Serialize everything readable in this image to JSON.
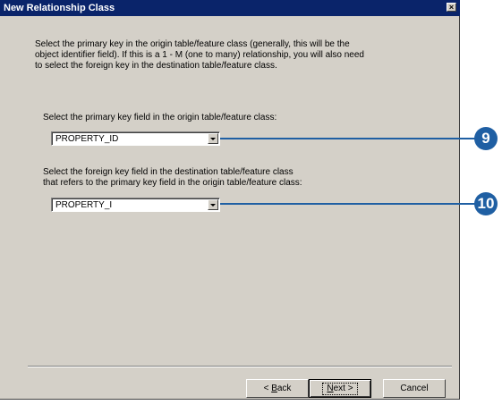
{
  "window": {
    "title": "New Relationship Class",
    "close_glyph": "×"
  },
  "instructions": [
    "Select the primary key in the origin table/feature class (generally, this will be the",
    "object identifier field). If this is a 1 - M (one to many) relationship, you will also need",
    "to select the foreign key in the destination table/feature class."
  ],
  "primary_key": {
    "label": "Select the primary key field in the origin table/feature class:",
    "value": "PROPERTY_ID"
  },
  "foreign_key": {
    "label_line1": "Select the foreign key field in the destination table/feature class",
    "label_line2": "that refers to the primary key field in the origin table/feature class:",
    "value": "PROPERTY_I"
  },
  "callouts": [
    {
      "number": "9",
      "color": "#1f5fa3"
    },
    {
      "number": "10",
      "color": "#1f5fa3"
    }
  ],
  "buttons": {
    "back_prefix": "< ",
    "back_mnemonic": "B",
    "back_rest": "ack",
    "next_mnemonic": "N",
    "next_rest": "ext >",
    "cancel": "Cancel"
  }
}
